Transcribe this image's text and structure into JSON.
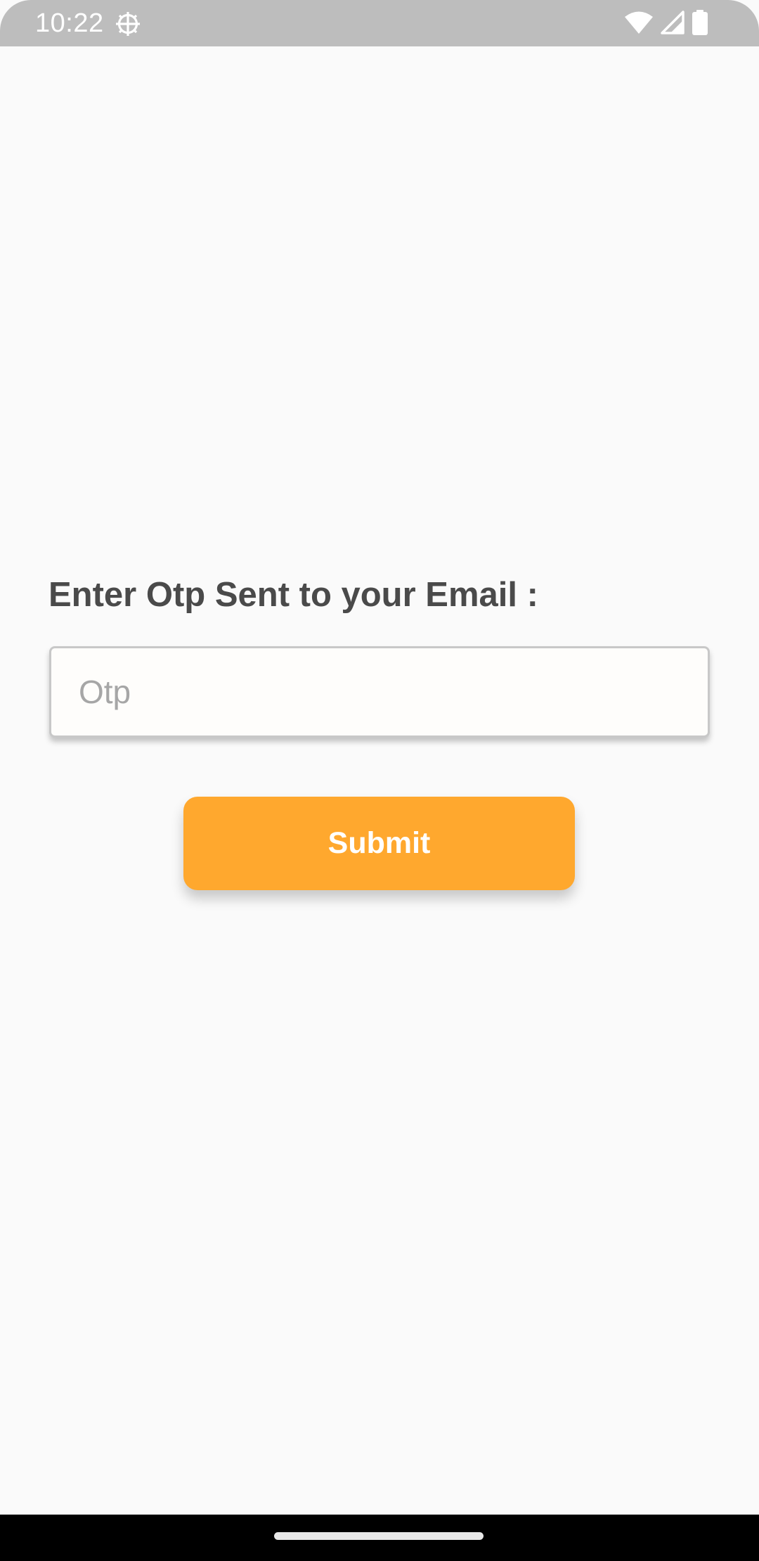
{
  "status_bar": {
    "time": "10:22",
    "icons": [
      "settings-gear-icon",
      "wifi-icon",
      "cellular-signal-icon",
      "battery-icon"
    ]
  },
  "otp_form": {
    "label": "Enter Otp Sent to your Email :",
    "input_placeholder": "Otp",
    "input_value": "",
    "submit_label": "Submit"
  },
  "colors": {
    "accent": "#ffa82e",
    "label_text": "#4a4a4a",
    "placeholder_text": "#a6a6a6",
    "status_bar": "#bdbdbd",
    "background": "#fafafa"
  }
}
